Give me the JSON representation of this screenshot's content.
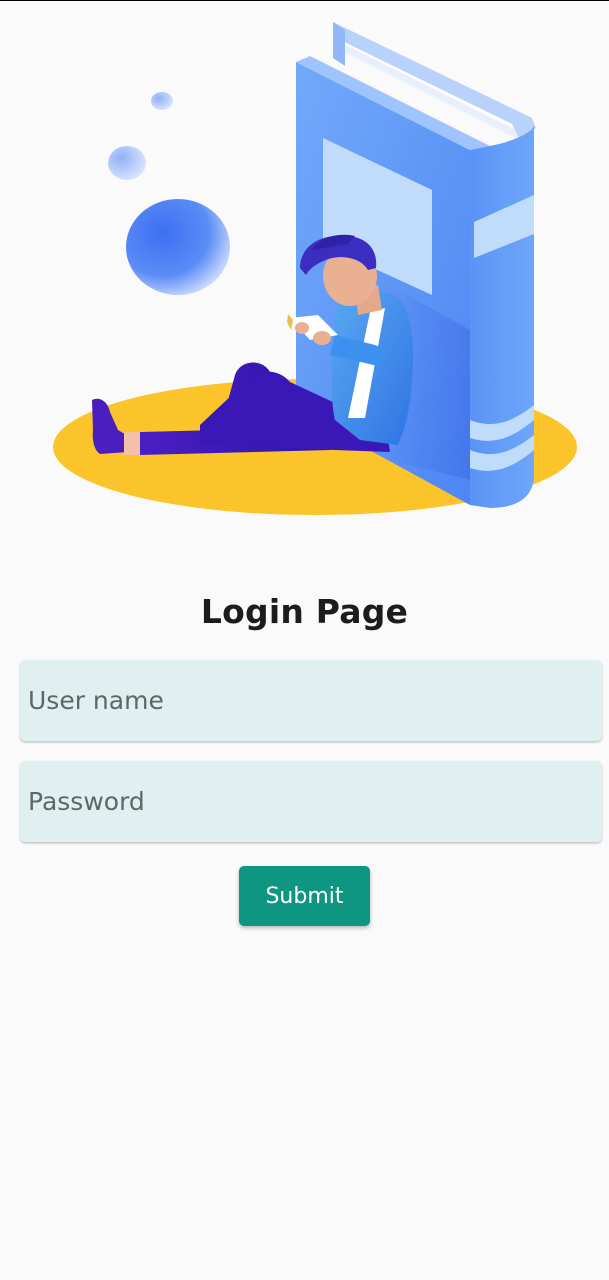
{
  "page": {
    "title": "Login Page"
  },
  "form": {
    "username_placeholder": "User name",
    "password_placeholder": "Password",
    "username_value": "",
    "password_value": "",
    "submit_label": "Submit"
  },
  "illustration": {
    "name": "person-reading-against-book",
    "colors": {
      "ground": "#fbc42a",
      "book": "#5f9df9",
      "bubbles": "#4f7ef5",
      "pants": "#3a18b8",
      "shirt": "#3d8ff0"
    }
  },
  "theme": {
    "background": "#fafafa",
    "field_bg": "#e0f0f0",
    "accent": "#0f9683"
  }
}
